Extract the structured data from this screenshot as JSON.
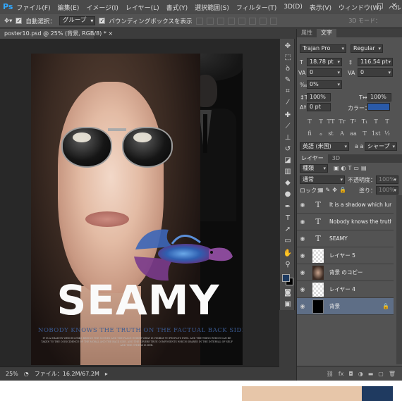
{
  "app": {
    "logo": "Ps"
  },
  "menu": [
    "ファイル(F)",
    "編集(E)",
    "イメージ(I)",
    "レイヤー(L)",
    "書式(Y)",
    "選択範囲(S)",
    "フィルター(T)",
    "3D(D)",
    "表示(V)",
    "ウィンドウ(W)",
    "ヘルプ(H)"
  ],
  "window_controls": {
    "minimize": "–",
    "restore": "□",
    "close": "✕"
  },
  "options_bar": {
    "auto_select_label": "自動選択：",
    "auto_select_value": "グループ",
    "bounding_box_label": "バウンディングボックスを表示",
    "mode_3d_label": "3D モード："
  },
  "document": {
    "tab_title": "poster10.psd @ 25% (背景, RGB/8) *",
    "close": "×"
  },
  "poster": {
    "title": "SEAMY",
    "subtitle": "NOBODY KNOWS THE TRUTH ON THE FACTUAL BACK SIDE",
    "body_text": "IT IS A SHADOW WHICH LURKS BEHIND THE SCENES AND THE PLACE WHERE WHAT IS VISIBLE TO PEOPLE'S EYES. AND THE THING WHICH CAN BE TAKEN TO THE COINCIDENCE OF THE MORAL AND THE BACK SIDE. AND THE SEVERE TRUE COMPONENTS WHICH SHARED IN THE INTERVAL OF SELF AND THE OTHERS IS HER."
  },
  "status": {
    "zoom": "25%",
    "file_info": "ファイル：16.2M/67.2M",
    "arrow": "▸"
  },
  "character_panel": {
    "tabs": [
      "属性",
      "文字"
    ],
    "active_tab": "文字",
    "font_family": "Trajan Pro",
    "font_style": "Regular",
    "font_size": "18.78 pt",
    "leading": "116.54 pt",
    "kerning": "0",
    "tracking": "0",
    "tsume": "0%",
    "vertical_scale": "100%",
    "horizontal_scale": "100%",
    "baseline_shift": "0 pt",
    "color_label": "カラー：",
    "language": "英語 (米国)",
    "anti_alias_label": "a a",
    "anti_alias": "シャープ",
    "type_buttons": [
      "T",
      "T",
      "TT",
      "Tr",
      "T¹",
      "T₁",
      "T",
      "T"
    ],
    "opentype_buttons": [
      "fi",
      "ℴ",
      "st",
      "A",
      "aa",
      "T",
      "1st",
      "½"
    ]
  },
  "layers_panel": {
    "tabs": [
      "レイヤー",
      "3D"
    ],
    "active_tab": "レイヤー",
    "filter_label": "種類",
    "blend_mode": "通常",
    "opacity_label": "不透明度：",
    "opacity": "100%",
    "lock_label": "ロック：",
    "fill_label": "塗り：",
    "fill": "100%",
    "layers": [
      {
        "name": "It is a shadow which lurks...",
        "type": "text",
        "selected": false
      },
      {
        "name": "Nobody knows the truth ...",
        "type": "text",
        "selected": false
      },
      {
        "name": "SEAMY",
        "type": "text",
        "selected": false
      },
      {
        "name": "レイヤー 5",
        "type": "transparent",
        "selected": false
      },
      {
        "name": "背景 のコピー",
        "type": "photo",
        "selected": false
      },
      {
        "name": "レイヤー 4",
        "type": "transparent",
        "selected": false
      },
      {
        "name": "背景",
        "type": "background",
        "selected": true
      }
    ],
    "footer_icons": [
      "link-icon",
      "fx-icon",
      "mask-icon",
      "adjustment-icon",
      "group-icon",
      "new-layer-icon",
      "trash-icon"
    ]
  },
  "tools": [
    "move-icon",
    "marquee-icon",
    "lasso-icon",
    "quick-select-icon",
    "crop-icon",
    "eyedropper-icon",
    "healing-icon",
    "brush-icon",
    "stamp-icon",
    "history-brush-icon",
    "eraser-icon",
    "gradient-icon",
    "blur-icon",
    "dodge-icon",
    "pen-icon",
    "type-icon",
    "path-select-icon",
    "shape-icon",
    "hand-icon",
    "zoom-icon"
  ],
  "colors": {
    "foreground": "#1d3a60",
    "background": "#000000",
    "text_color": "#2a5aa8",
    "strip": [
      "#000000",
      "#ffffff",
      "#e7c6a9",
      "#1f3a60",
      "#ffffff"
    ]
  }
}
